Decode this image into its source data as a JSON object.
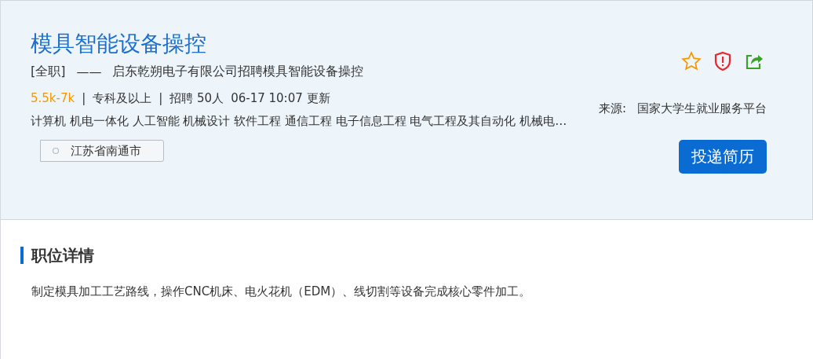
{
  "job": {
    "title": "模具智能设备操控",
    "employment_type": "[全职]",
    "dash": "——",
    "headline": "启东乾朔电子有限公司招聘模具智能设备操控",
    "meta": [
      {
        "kind": "salary",
        "text": "5.5k-7k"
      },
      {
        "kind": "separator",
        "text": "|"
      },
      {
        "kind": "plain",
        "text": "专科及以上"
      },
      {
        "kind": "separator",
        "text": "|"
      },
      {
        "kind": "plain",
        "text": "招聘 50人"
      },
      {
        "kind": "plain",
        "text": "06-17 10:07 更新"
      }
    ],
    "majors": "计算机 机电一体化 人工智能 机械设计 软件工程 通信工程 电子信息工程 电气工程及其自动化 机械电…",
    "location": "江苏省南通市",
    "actions": [
      {
        "kind": "star"
      },
      {
        "kind": "report"
      },
      {
        "kind": "share"
      }
    ],
    "source_label": "来源:",
    "source": "国家大学生就业服务平台",
    "apply_button": "投递简历"
  },
  "details": {
    "heading": "职位详情",
    "description": "制定模具加工工艺路线，操作CNC机床、电火花机（EDM）、线切割等设备完成核心零件加工。"
  }
}
